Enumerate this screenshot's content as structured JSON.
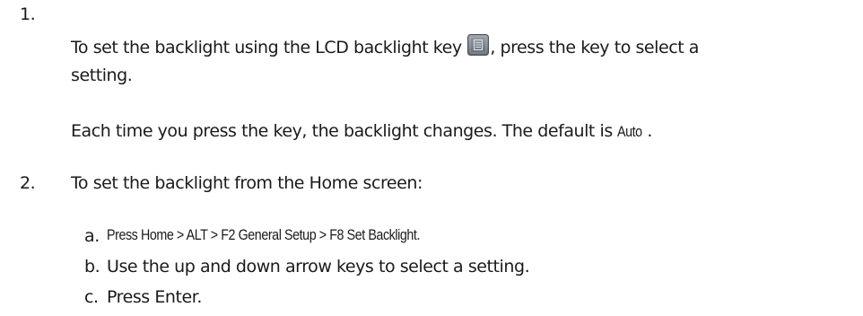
{
  "step1": {
    "number": "1.",
    "line1_before_icon": "To set the backlight using the LCD backlight key ",
    "line1_after_icon": ", press the key to select a",
    "line2": "setting.",
    "note_prefix": "Each time you press the key, the backlight changes. The default is ",
    "note_value": "Auto",
    "note_suffix": "."
  },
  "step2": {
    "number": "2.",
    "text": "To set the backlight from the Home screen:",
    "substeps": [
      {
        "letter": "a.",
        "text": "Press Home > ALT > F2 General Setup > F8 Set Backlight."
      },
      {
        "letter": "b.",
        "text": "Use the up and down arrow keys to select a setting."
      },
      {
        "letter": "c.",
        "text": "Press Enter."
      }
    ]
  },
  "icons": {
    "backlight_key": "lcd-backlight-key-icon"
  }
}
